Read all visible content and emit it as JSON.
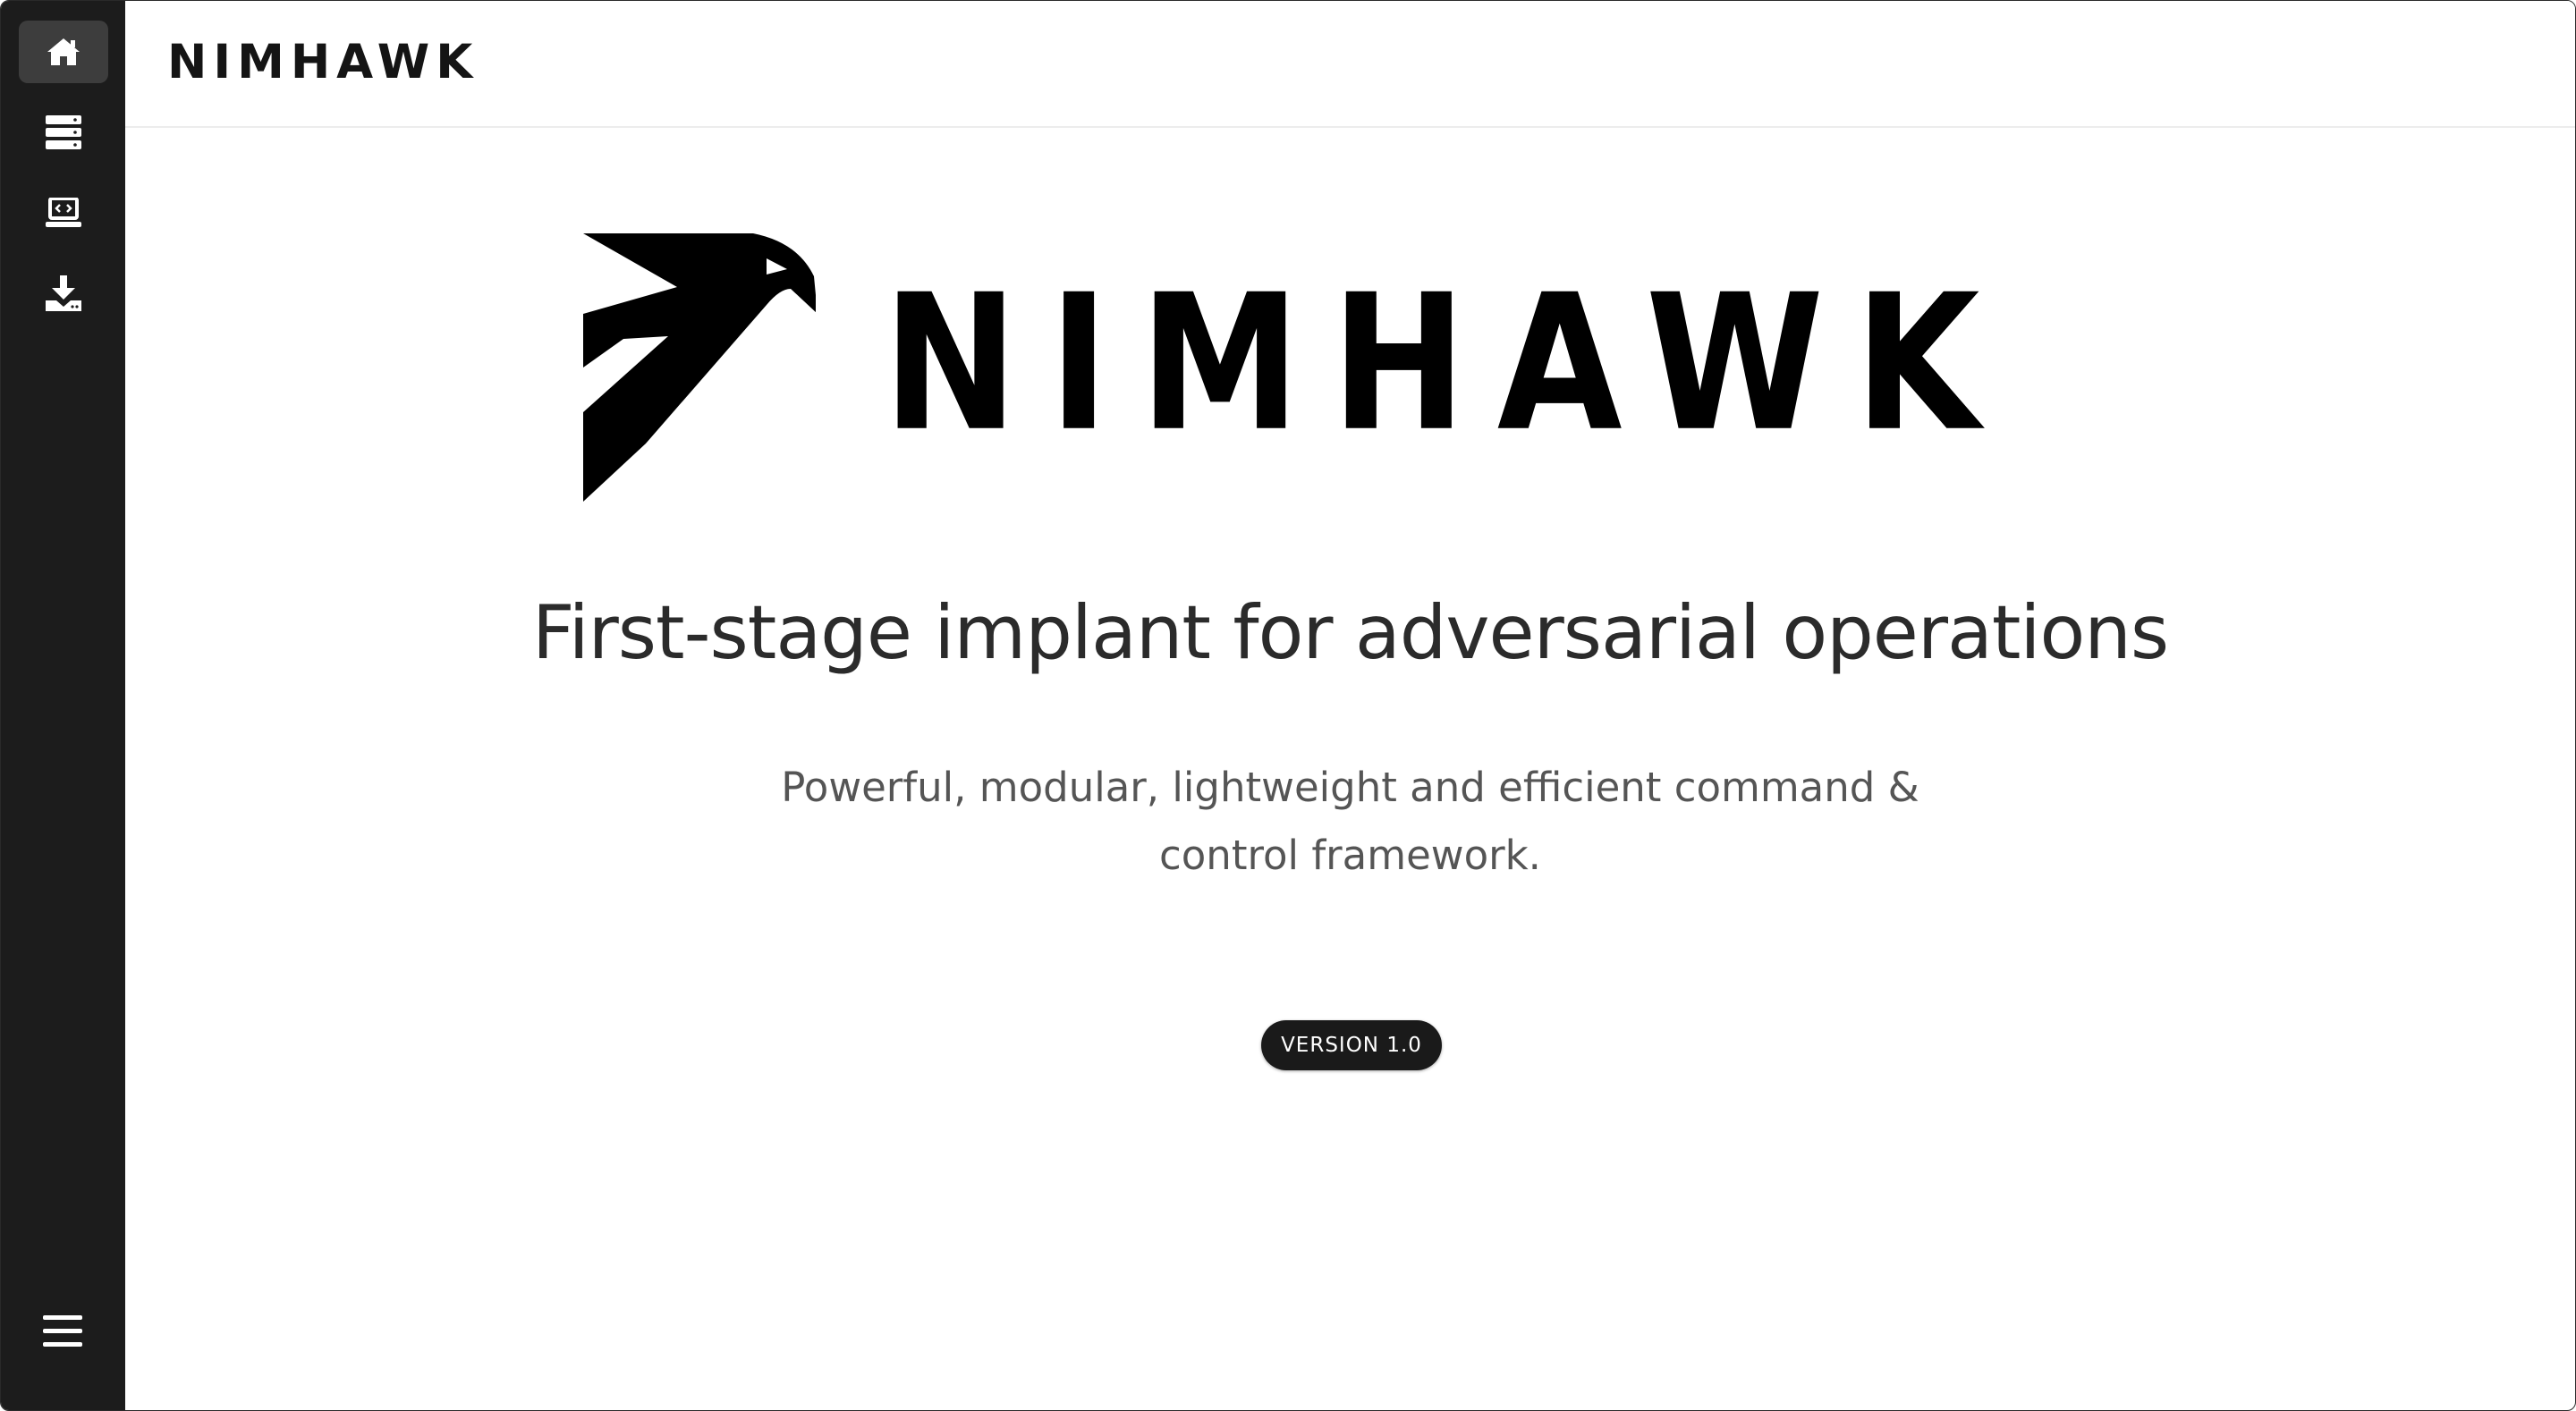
{
  "header": {
    "brand": "NIMHAWK"
  },
  "sidebar": {
    "items": [
      {
        "icon": "home-icon",
        "active": true
      },
      {
        "icon": "server-icon",
        "active": false
      },
      {
        "icon": "laptop-code-icon",
        "active": false
      },
      {
        "icon": "download-icon",
        "active": false
      }
    ],
    "menu_icon": "hamburger-menu-icon"
  },
  "hero": {
    "logo_text": "NIMHAWK",
    "headline": "First-stage implant for adversarial operations",
    "subline": "Powerful, modular, lightweight and efficient command & control framework.",
    "version_badge": "VERSION 1.0"
  },
  "colors": {
    "sidebar_bg": "#1c1c1c",
    "active_item_bg": "#3d3d3d",
    "badge_bg": "#1a1a1a",
    "text_dark": "#2b2b2b",
    "text_muted": "#555555"
  }
}
